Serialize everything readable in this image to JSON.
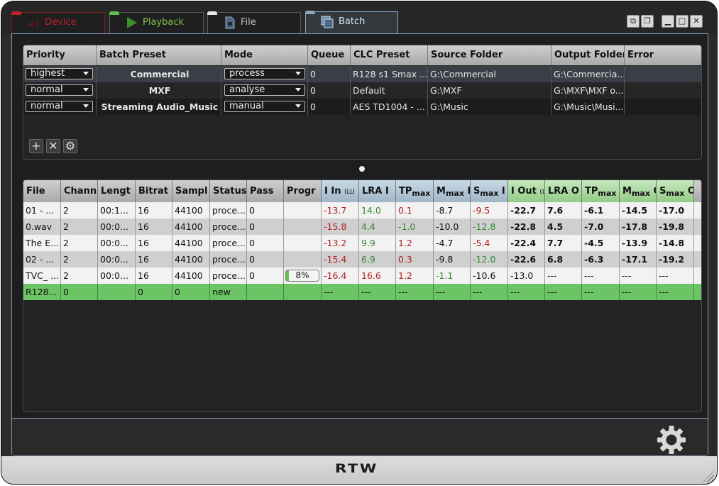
{
  "brand": "RTW",
  "tabs": [
    {
      "label": "Device"
    },
    {
      "label": "Playback"
    },
    {
      "label": "File"
    },
    {
      "label": "Batch"
    }
  ],
  "colors": {
    "device_accent": "#c0202a",
    "playback_accent": "#5fc24a",
    "batch_accent": "#8aa9c4",
    "ok_green": "#6dc465"
  },
  "batch_table": {
    "headers": [
      "Priority",
      "Batch Preset",
      "Mode",
      "Queue",
      "CLC Preset",
      "Source Folder",
      "Output Folder",
      "Error"
    ],
    "rows": [
      {
        "priority": "highest",
        "preset": "Commercial",
        "mode": "process",
        "queue": "0",
        "clc": "R128 s1 Smax ...",
        "source": "G:\\Commercial",
        "output": "G:\\Commercia...",
        "error": ""
      },
      {
        "priority": "normal",
        "preset": "MXF",
        "mode": "analyse",
        "queue": "0",
        "clc": "Default",
        "source": "G:\\MXF",
        "output": "G:\\MXF\\MXF o...",
        "error": ""
      },
      {
        "priority": "normal",
        "preset": "Streaming Audio_Music",
        "mode": "manual",
        "queue": "0",
        "clc": "AES TD1004 - ...",
        "source": "G:\\Music",
        "output": "G:\\Music\\Musi...",
        "error": ""
      }
    ],
    "actions": [
      "add-icon",
      "close-icon",
      "gear-icon"
    ]
  },
  "file_table": {
    "headers": {
      "file": "File",
      "chann": "Chann",
      "length": "Lengt",
      "bitrate": "Bitrat",
      "sample": "Sampl",
      "status": "Status",
      "pass": "Pass",
      "progress": "Progr",
      "i_in": "I In",
      "i_in_unit": "(LU",
      "lra_in": "LRA I",
      "tp_in": "TP",
      "tp_in_sub": "max",
      "m_in": "M",
      "m_in_sub": "max",
      "m_in_suffix": " I",
      "s_in": "S",
      "s_in_sub": "max",
      "s_in_suffix": " I",
      "i_out": "I Out",
      "i_out_unit": "(L",
      "lra_out": "LRA O",
      "tp_out": "TP",
      "tp_out_sub": "max",
      "m_out": "M",
      "m_out_sub": "max",
      "m_out_suffix": " O",
      "s_out": "S",
      "s_out_sub": "max",
      "s_out_suffix": " O"
    },
    "rows": [
      {
        "file": "01 - ...",
        "chann": "2",
        "length": "00:1...",
        "bitrate": "16",
        "sample": "44100",
        "status": "proce...",
        "pass": "0",
        "progress": "",
        "i_in": "-13.7",
        "lra_in": "14.0",
        "tp_in": "0.1",
        "m_in": "-8.7",
        "s_in": "-9.5",
        "i_out": "-22.7",
        "lra_out": "7.6",
        "tp_out": "-6.1",
        "m_out": "-14.5",
        "s_out": "-17.0"
      },
      {
        "file": "0.wav",
        "chann": "2",
        "length": "00:0...",
        "bitrate": "16",
        "sample": "44100",
        "status": "proce...",
        "pass": "0",
        "progress": "",
        "i_in": "-15.8",
        "lra_in": "4.4",
        "tp_in": "-1.0",
        "m_in": "-10.0",
        "s_in": "-12.8",
        "i_out": "-22.8",
        "lra_out": "4.5",
        "tp_out": "-7.0",
        "m_out": "-17.8",
        "s_out": "-19.8"
      },
      {
        "file": "The E...",
        "chann": "2",
        "length": "00:0...",
        "bitrate": "16",
        "sample": "44100",
        "status": "proce...",
        "pass": "0",
        "progress": "",
        "i_in": "-13.2",
        "lra_in": "9.9",
        "tp_in": "1.2",
        "m_in": "-4.7",
        "s_in": "-5.4",
        "i_out": "-22.4",
        "lra_out": "7.7",
        "tp_out": "-4.5",
        "m_out": "-13.9",
        "s_out": "-14.8"
      },
      {
        "file": "02 - ...",
        "chann": "2",
        "length": "00:0...",
        "bitrate": "16",
        "sample": "44100",
        "status": "proce...",
        "pass": "0",
        "progress": "",
        "i_in": "-15.4",
        "lra_in": "6.9",
        "tp_in": "0.3",
        "m_in": "-9.8",
        "s_in": "-12.0",
        "i_out": "-22.6",
        "lra_out": "6.8",
        "tp_out": "-6.3",
        "m_out": "-17.1",
        "s_out": "-19.2"
      },
      {
        "file": "TVC_ ...",
        "chann": "2",
        "length": "00:0...",
        "bitrate": "16",
        "sample": "44100",
        "status": "proce...",
        "pass": "0",
        "progress": "8%",
        "progress_value": 0.08,
        "i_in": "-16.4",
        "lra_in": "16.6",
        "tp_in": "1.2",
        "m_in": "-1.1",
        "s_in": "-10.6",
        "i_out": "-13.0",
        "lra_out": "---",
        "tp_out": "---",
        "m_out": "---",
        "s_out": "---"
      },
      {
        "file": "R128...",
        "chann": "0",
        "length": "",
        "bitrate": "0",
        "sample": "0",
        "status": "new",
        "pass": "",
        "progress": "",
        "i_in": "---",
        "lra_in": "---",
        "tp_in": "---",
        "m_in": "---",
        "s_in": "---",
        "i_out": "---",
        "lra_out": "---",
        "tp_out": "---",
        "m_out": "---",
        "s_out": "---"
      }
    ]
  }
}
